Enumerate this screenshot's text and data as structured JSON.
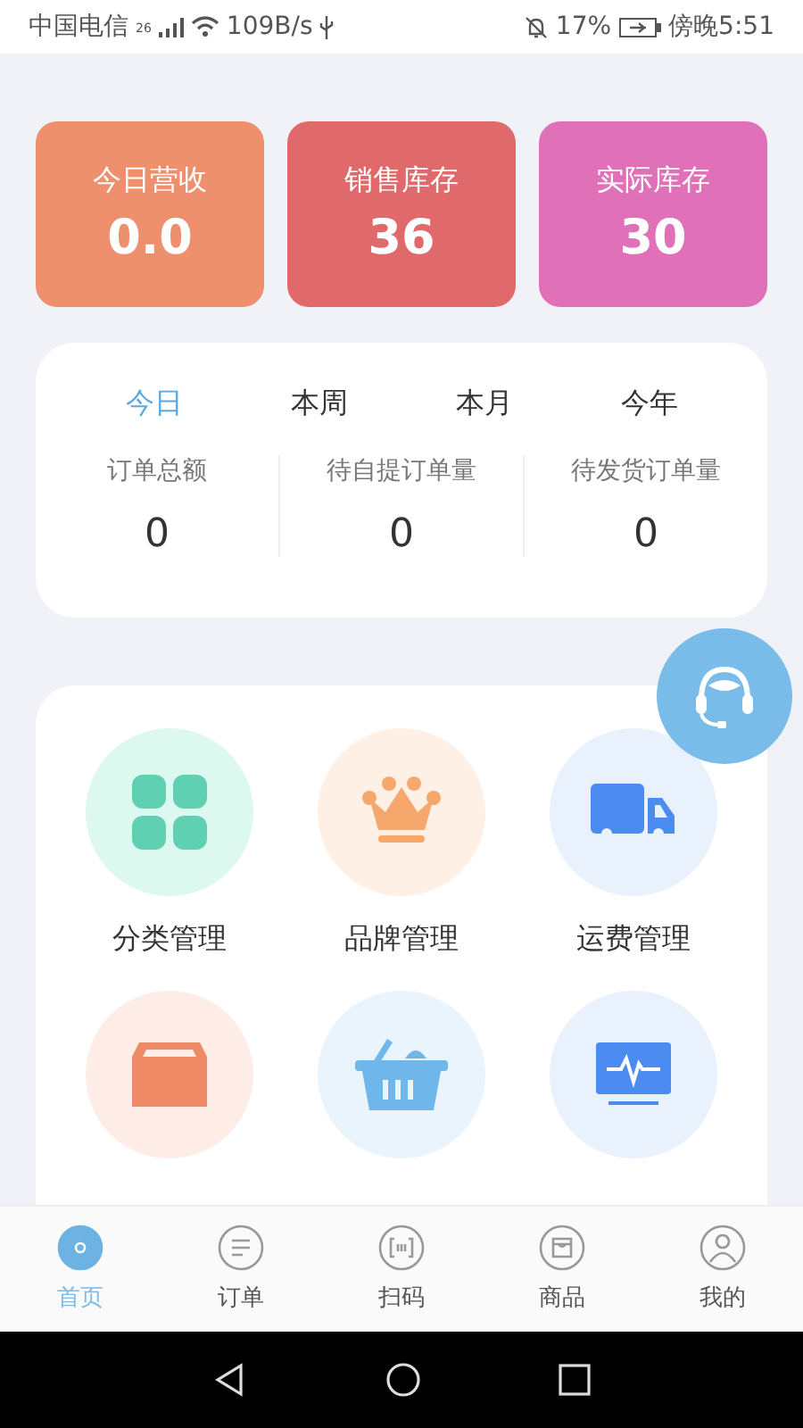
{
  "status_bar": {
    "carrier": "中国电信",
    "network": "26",
    "speed": "109B/s",
    "battery": "17%",
    "time": "傍晚5:51"
  },
  "stat_cards": [
    {
      "label": "今日营收",
      "value": "0.0",
      "color": "#ee8f6e"
    },
    {
      "label": "销售库存",
      "value": "36",
      "color": "#e0696c"
    },
    {
      "label": "实际库存",
      "value": "30",
      "color": "#e070b8"
    }
  ],
  "period_tabs": [
    {
      "label": "今日",
      "selected": true
    },
    {
      "label": "本周",
      "selected": false
    },
    {
      "label": "本月",
      "selected": false
    },
    {
      "label": "今年",
      "selected": false
    }
  ],
  "order_stats": [
    {
      "label": "订单总额",
      "value": "0"
    },
    {
      "label": "待自提订单量",
      "value": "0"
    },
    {
      "label": "待发货订单量",
      "value": "0"
    }
  ],
  "functions": [
    {
      "kind": "grid",
      "label": "分类管理"
    },
    {
      "kind": "crown",
      "label": "品牌管理"
    },
    {
      "kind": "truck",
      "label": "运费管理"
    },
    {
      "kind": "box"
    },
    {
      "kind": "basket"
    },
    {
      "kind": "monitor"
    }
  ],
  "bottom_nav": [
    {
      "kind": "home",
      "label": "首页",
      "selected": true
    },
    {
      "kind": "order",
      "label": "订单",
      "selected": false
    },
    {
      "kind": "scan",
      "label": "扫码",
      "selected": false
    },
    {
      "kind": "goods",
      "label": "商品",
      "selected": false
    },
    {
      "kind": "mine",
      "label": "我的",
      "selected": false
    }
  ]
}
